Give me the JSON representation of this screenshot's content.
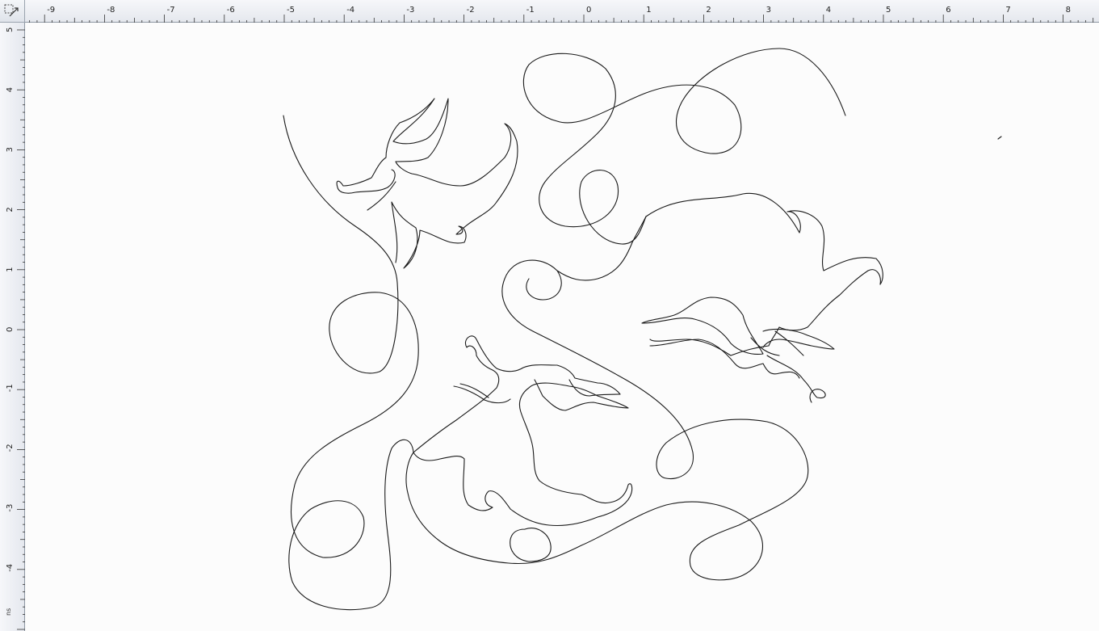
{
  "rulers": {
    "horizontal_labels": [
      "-9",
      "-8",
      "-7",
      "-6",
      "-5",
      "-4",
      "-3",
      "-2",
      "-1",
      "0",
      "1",
      "2",
      "3",
      "4",
      "5",
      "6",
      "7",
      "8"
    ],
    "vertical_labels": [
      "5",
      "4",
      "3",
      "2",
      "1",
      "0",
      "-1",
      "-2",
      "-3",
      "-4"
    ],
    "units_label": "ns"
  },
  "canvas": {
    "stroke_color": "#1a1a1a",
    "background_color": "#fcfcfc"
  },
  "corner": {
    "icon": "ruler-origin-icon"
  }
}
